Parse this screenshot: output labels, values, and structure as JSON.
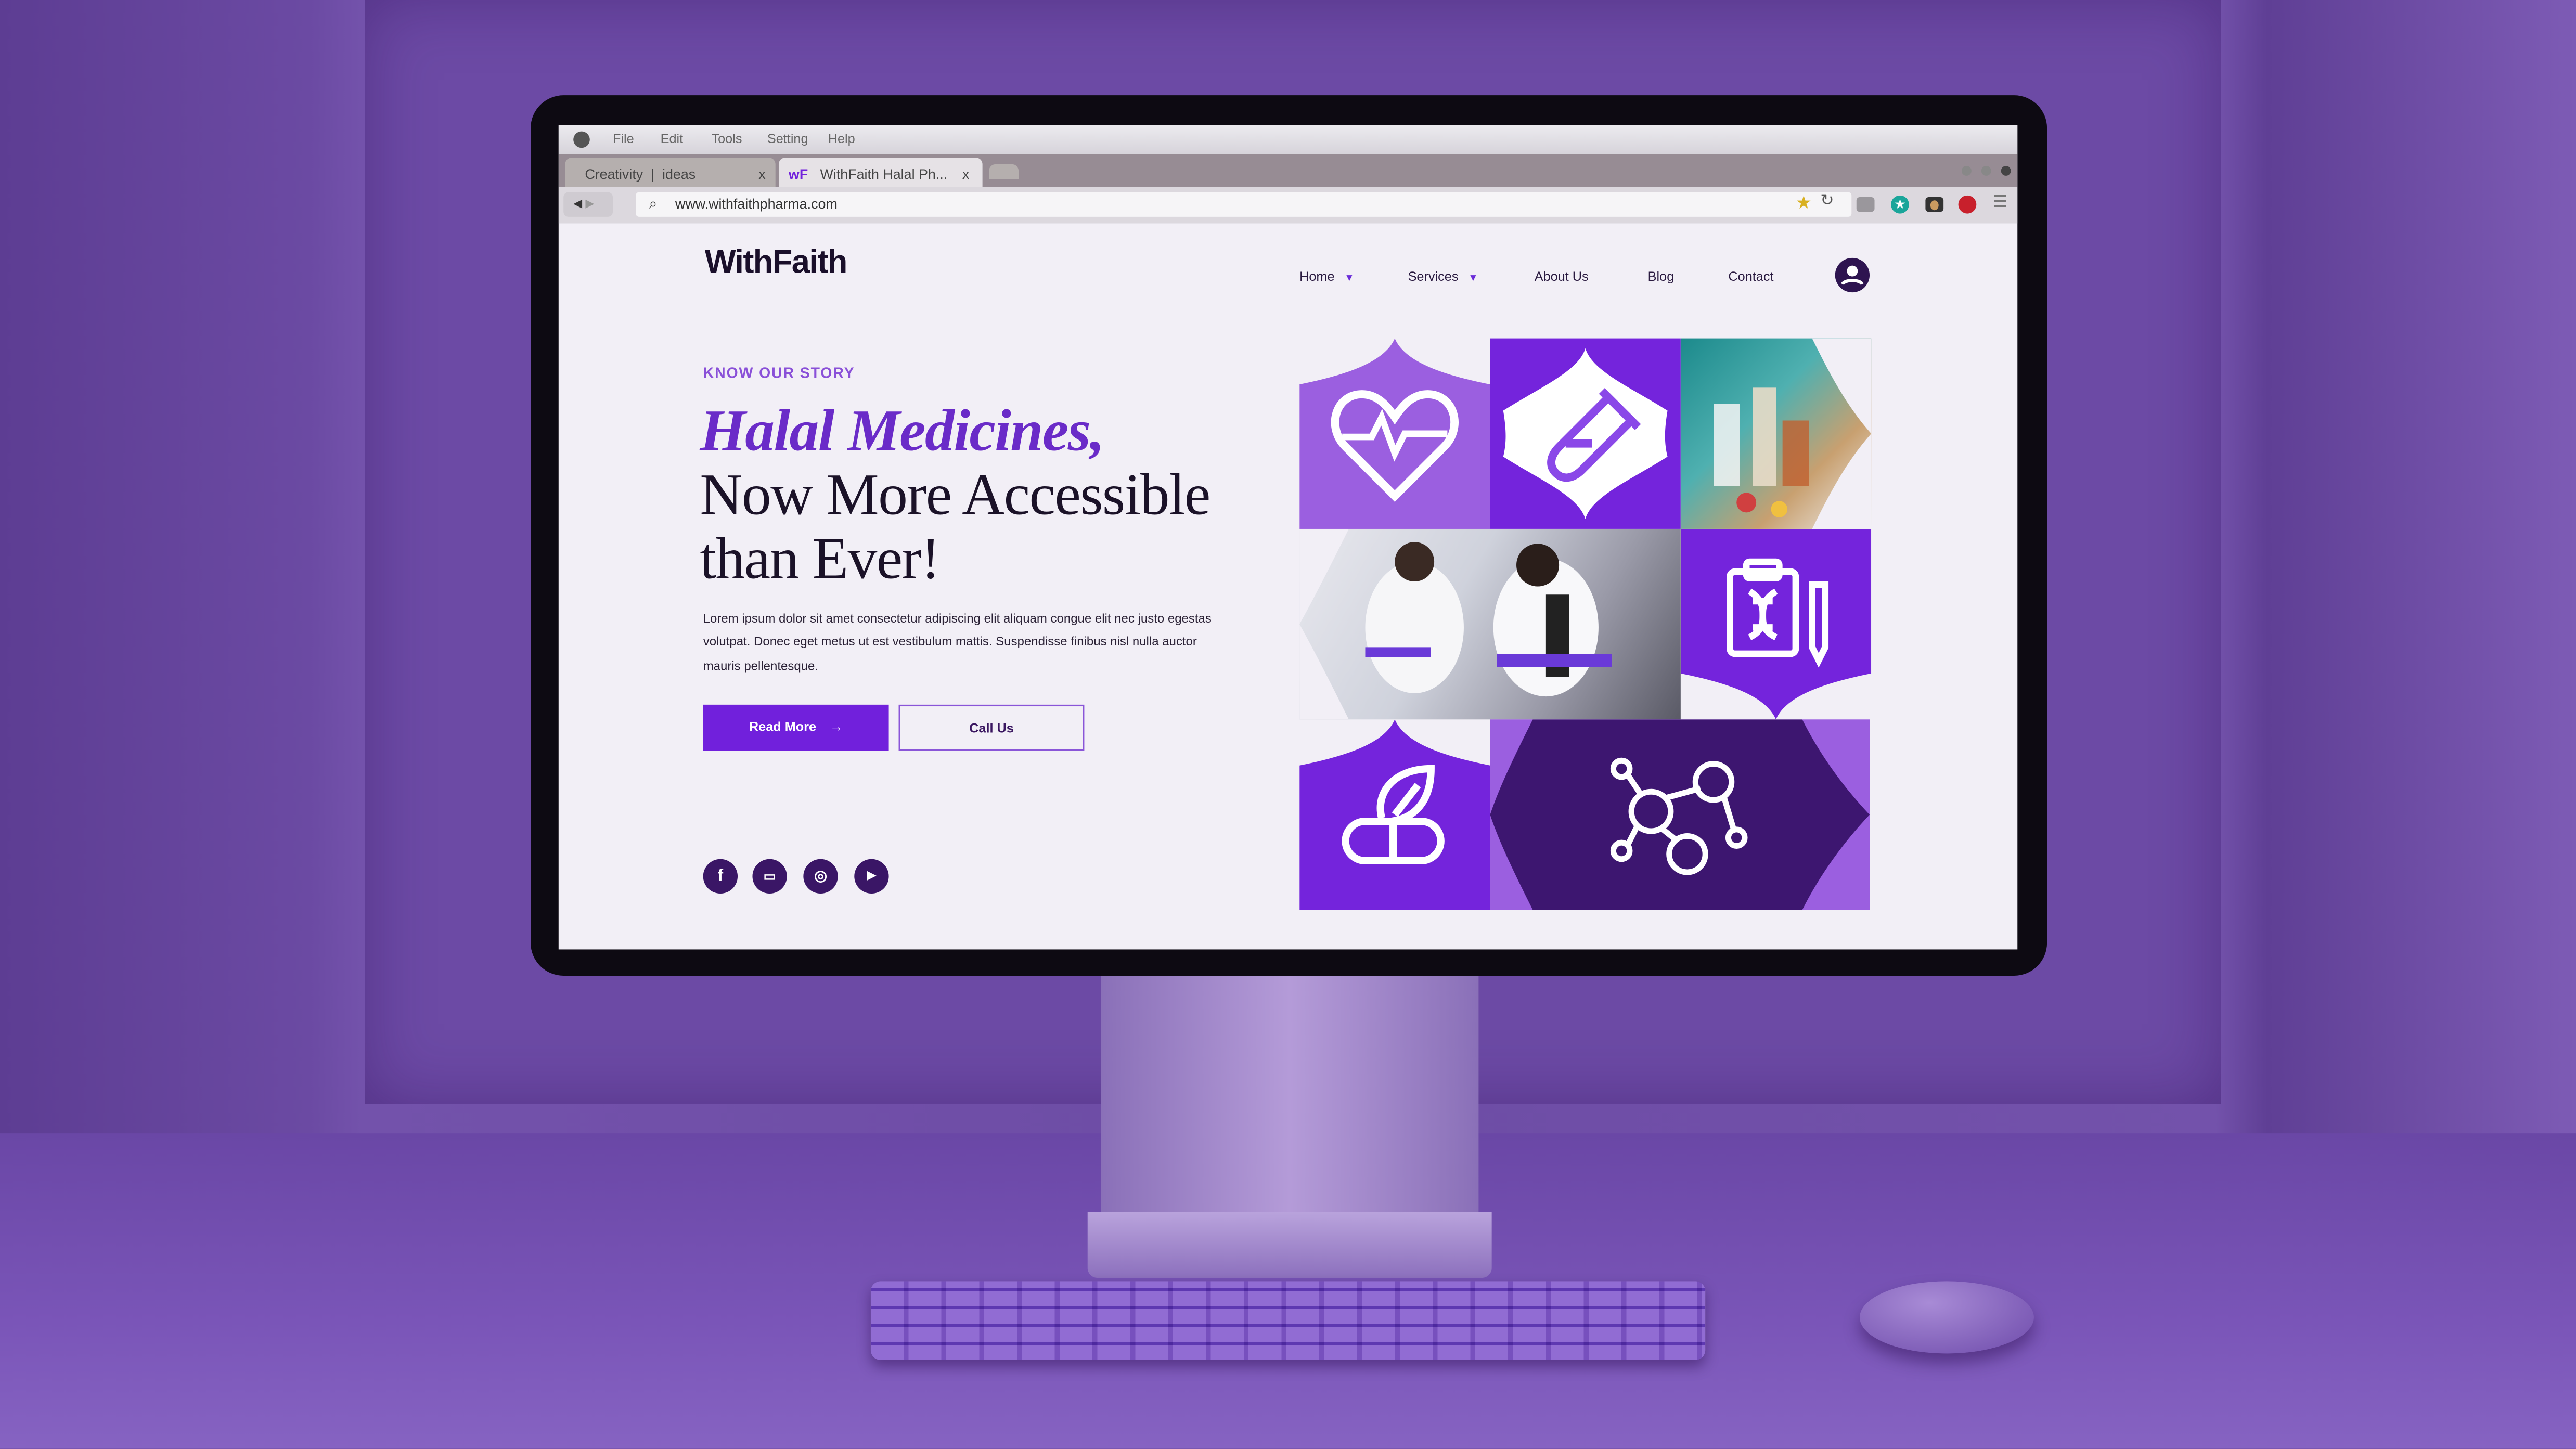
{
  "browser": {
    "menu": [
      "File",
      "Edit",
      "Tools",
      "Setting",
      "Help"
    ],
    "tabs": [
      {
        "label": "Creativity  |  ideas",
        "close": "x"
      },
      {
        "label": "WithFaith Halal Ph...",
        "close": "x",
        "favicon": "wf-logo"
      }
    ],
    "url": "www.withfaithpharma.com",
    "toolbar_icons": [
      "star-icon",
      "reload-icon",
      "extension-gray-icon",
      "extension-teal-star-icon",
      "extension-camera-icon",
      "extension-red-icon",
      "hamburger-menu-icon"
    ]
  },
  "site": {
    "logo": "WithFaith",
    "nav": [
      {
        "label": "Home",
        "dropdown": true
      },
      {
        "label": "Services",
        "dropdown": true
      },
      {
        "label": "About Us"
      },
      {
        "label": "Blog"
      },
      {
        "label": "Contact"
      }
    ],
    "hero": {
      "kicker": "KNOW OUR STORY",
      "title_line1": "Halal Medicines,",
      "title_line2": "Now More Accessible",
      "title_line3": "than Ever!",
      "body": "Lorem ipsum dolor sit amet consectetur adipiscing elit aliquam congue elit nec justo egestas volutpat. Donec eget metus ut est vestibulum mattis. Suspendisse finibus nisl nulla auctor mauris pellentesque.",
      "primary_button": "Read More",
      "secondary_button": "Call Us"
    },
    "social": [
      "facebook-icon",
      "twitch-icon",
      "instagram-icon",
      "youtube-icon"
    ],
    "colors": {
      "primary": "#7120dc",
      "dark": "#3d1670",
      "light": "#9b5fe0",
      "background": "#f2eff6"
    }
  }
}
